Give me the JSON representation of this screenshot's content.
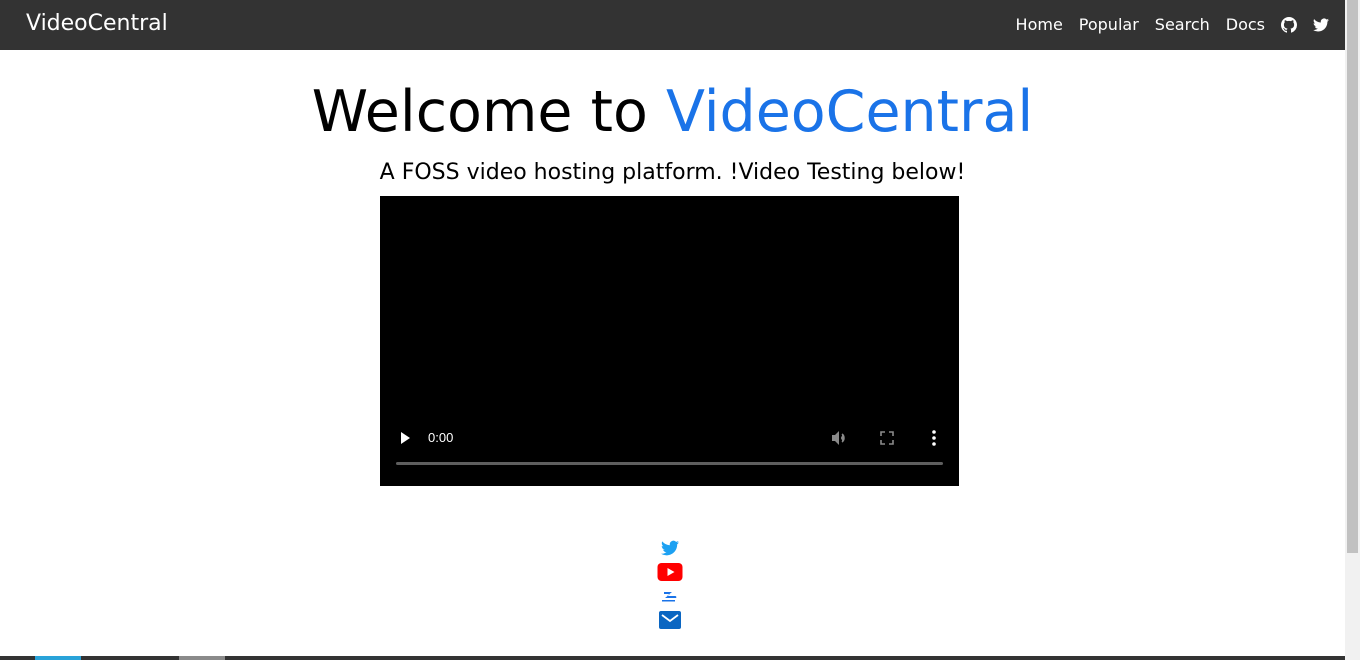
{
  "navbar": {
    "brand": "VideoCentral",
    "links": [
      "Home",
      "Popular",
      "Search",
      "Docs"
    ],
    "icons": [
      "github-icon",
      "twitter-icon"
    ],
    "background": "#333333"
  },
  "hero": {
    "title_prefix": "Welcome to ",
    "title_accent": "VideoCentral",
    "accent_color": "#1a73e8",
    "subtitle": "A FOSS video hosting platform. !Video Testing below!"
  },
  "video": {
    "time": "0:00",
    "progress": 0
  },
  "social": {
    "icons": [
      "twitter-icon",
      "youtube-icon",
      "odysee-icon",
      "email-icon"
    ],
    "colors": {
      "twitter": "#1da1f2",
      "youtube": "#ff0000",
      "odysee": "#1a73e8",
      "email": "#0a66c2"
    }
  }
}
